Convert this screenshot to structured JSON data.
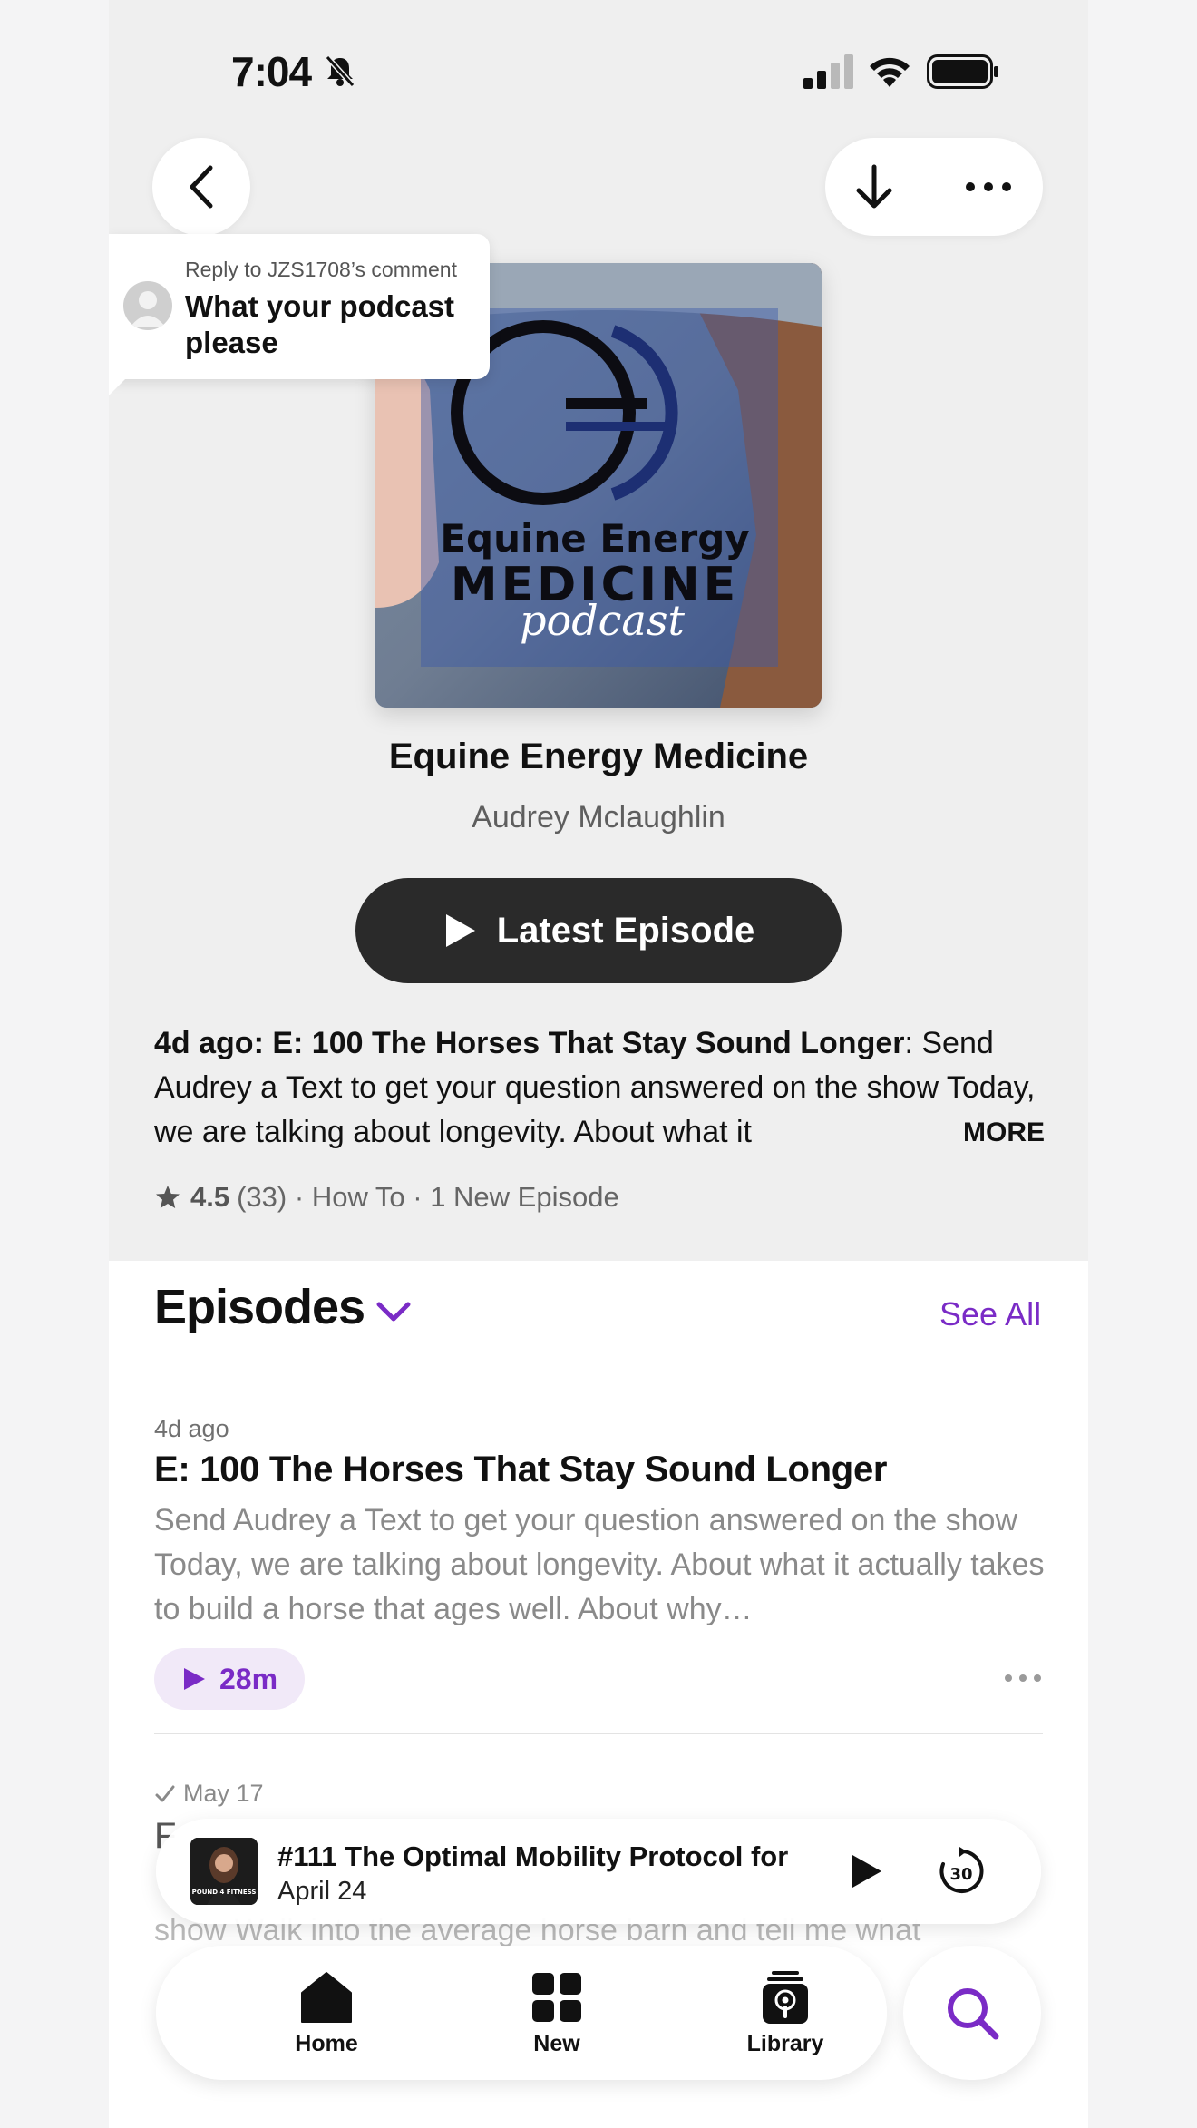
{
  "status_bar": {
    "time": "7:04",
    "icons": [
      "bell-slash-icon",
      "signal-icon",
      "wifi-icon",
      "battery-icon"
    ]
  },
  "nav": {
    "back_icon": "chevron-left-icon",
    "download_icon": "arrow-down-icon",
    "more_icon": "ellipsis-icon"
  },
  "tooltip": {
    "reply_to": "Reply to JZS1708’s comment",
    "text": "What your podcast please"
  },
  "podcast": {
    "artwork_text_line1": "Equine Energy",
    "artwork_text_line2": "MEDICINE",
    "artwork_text_line3": "podcast",
    "title": "Equine Energy Medicine",
    "author": "Audrey Mclaughlin",
    "latest_button": "Latest Episode",
    "description_lead": "4d ago: E: 100 The Horses That Stay Sound Longer",
    "description_body": ": Send Audrey a Text to get your question answered on the show  Today, we are talking about longevity. About what it",
    "more_label": "MORE",
    "rating": "4.5",
    "rating_count": "(33)",
    "category": "How To",
    "new_episodes": "1 New Episode"
  },
  "episodes": {
    "header": "Episodes",
    "see_all": "See All",
    "items": [
      {
        "date": "4d ago",
        "title": "E: 100 The Horses That Stay Sound Longer",
        "description": "Send Audrey a Text to get your question answered on the show  Today, we are talking about longevity. About what it actually takes to build a horse that ages well. About why…",
        "duration": "28m"
      },
      {
        "date": "May 17",
        "title": "F",
        "description": "show  Walk into the average horse barn and tell me what"
      }
    ]
  },
  "mini_player": {
    "title": "#111 The Optimal Mobility Protocol for",
    "subtitle": "April 24",
    "art_label": "POUND 4 FITNESS",
    "skip_label": "30"
  },
  "tabbar": {
    "tabs": [
      {
        "label": "Home",
        "icon": "house-icon"
      },
      {
        "label": "New",
        "icon": "grid-icon"
      },
      {
        "label": "Library",
        "icon": "podcast-stack-icon"
      }
    ],
    "search_icon": "magnifier-icon"
  },
  "colors": {
    "accent": "#7a2bc6",
    "button_dark": "#2a2a2a",
    "header_bg": "#efefef"
  }
}
